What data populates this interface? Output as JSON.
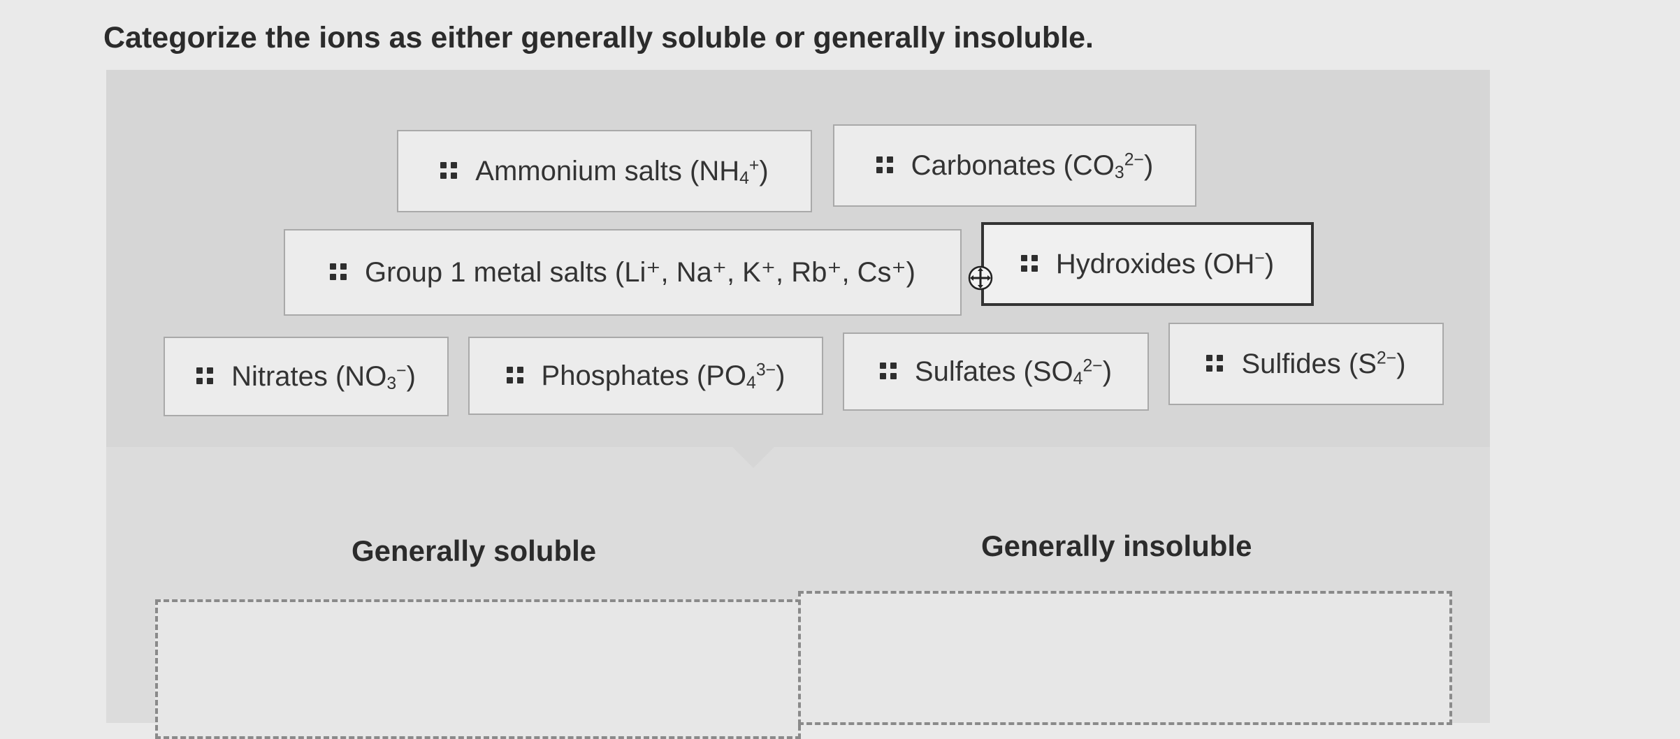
{
  "question": "Categorize the ions as either generally soluble or generally insoluble.",
  "items": [
    {
      "main": "Ammonium salts (NH",
      "sub": "4",
      "sup": "+",
      "end": ")"
    },
    {
      "main": "Carbonates (CO",
      "sub": "3",
      "sup": "2−",
      "end": ")"
    },
    {
      "main": "Group 1 metal salts (Li⁺, Na⁺, K⁺, Rb⁺, Cs⁺)"
    },
    {
      "main": "Hydroxides (OH",
      "sup": "−",
      "end": ")"
    },
    {
      "main": "Nitrates (NO",
      "sub": "3",
      "sup": "−",
      "end": ")"
    },
    {
      "main": "Phosphates (PO",
      "sub": "4",
      "sup": "3−",
      "end": ")"
    },
    {
      "main": "Sulfates (SO",
      "sub": "4",
      "sup": "2−",
      "end": ")"
    },
    {
      "main": "Sulfides (S",
      "sup": "2−",
      "end": ")"
    }
  ],
  "categories": {
    "soluble": "Generally soluble",
    "insoluble": "Generally insoluble"
  }
}
